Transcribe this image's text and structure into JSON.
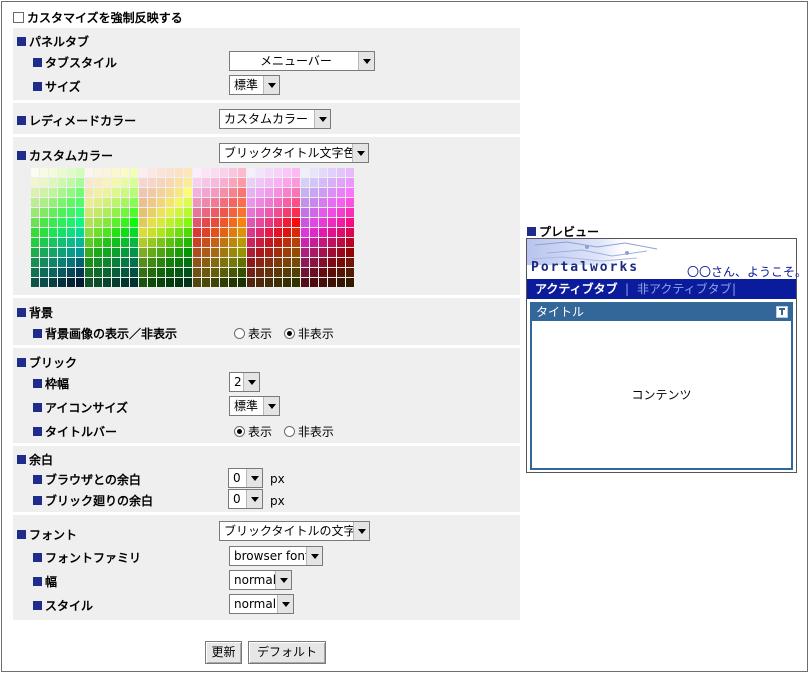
{
  "force_checkbox_label": "カスタマイズを強制反映する",
  "panel_tab": {
    "heading": "パネルタブ",
    "tab_style_label": "タブスタイル",
    "tab_style_value": "メニューバー",
    "size_label": "サイズ",
    "size_value": "標準"
  },
  "ready_made": {
    "label": "レディメードカラー",
    "value": "カスタムカラー"
  },
  "custom_color": {
    "label": "カスタムカラー",
    "value": "ブリックタイトル文字色"
  },
  "background": {
    "heading": "背景",
    "image_label": "背景画像の表示／非表示",
    "show": "表示",
    "hide": "非表示",
    "selected": "hide"
  },
  "brick": {
    "heading": "ブリック",
    "border_label": "枠幅",
    "border_value": "2",
    "icon_size_label": "アイコンサイズ",
    "icon_size_value": "標準",
    "titlebar_label": "タイトルバー",
    "show": "表示",
    "hide": "非表示",
    "selected": "show"
  },
  "margin": {
    "heading": "余白",
    "browser_label": "ブラウザとの余白",
    "browser_value": "0",
    "brick_label": "ブリック廻りの余白",
    "brick_value": "0",
    "unit": "px"
  },
  "font": {
    "label": "フォント",
    "value": "ブリックタイトルの文字",
    "family_label": "フォントファミリ",
    "family_value": "browser font",
    "width_label": "幅",
    "width_value": "normal",
    "style_label": "スタイル",
    "style_value": "normal"
  },
  "buttons": {
    "update": "更新",
    "default": "デフォルト"
  },
  "preview": {
    "heading": "プレビュー",
    "logo": "Portalworks",
    "welcome": "〇〇さん、ようこそ。",
    "active_tab": "アクティブタブ",
    "tab_sep": "|",
    "inactive_tab": "非アクティブタブ",
    "title": "タイトル",
    "content": "コンテンツ"
  },
  "colors": {
    "accent_square": "#1e2c8c",
    "preview_tabbar": "#0a1c9c",
    "brick_title": "#336699",
    "panel_bg": "#efefef"
  }
}
